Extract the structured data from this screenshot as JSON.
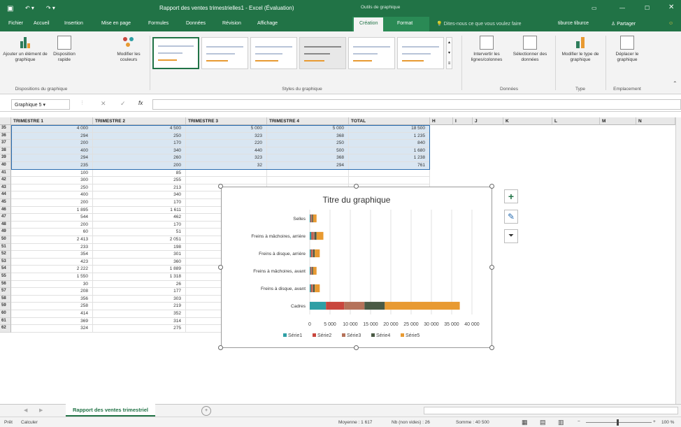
{
  "window": {
    "title": "Rapport des ventes trimestrielles1 - Excel (Évaluation)",
    "context_group": "Outils de graphique",
    "user": "tiburce tiburce"
  },
  "tabs": [
    "Fichier",
    "Accueil",
    "Insertion",
    "Mise en page",
    "Formules",
    "Données",
    "Révision",
    "Affichage",
    "Création",
    "Format"
  ],
  "active_tab": "Création",
  "tell_me": "Dites-nous ce que vous voulez faire",
  "share_label": "Partager",
  "ribbon": {
    "add_element": "Ajouter un élément de graphique",
    "quick_layout": "Disposition rapide",
    "group_layouts": "Dispositions du graphique",
    "change_colors": "Modifier les couleurs",
    "group_styles": "Styles du graphique",
    "switch_rowcol": "Intervertir les lignes/colonnes",
    "select_data": "Sélectionner des données",
    "group_data": "Données",
    "change_type": "Modifier le type de graphique",
    "group_type": "Type",
    "move_chart": "Déplacer le graphique",
    "group_location": "Emplacement"
  },
  "formula_bar": {
    "name_box": "Graphique 5",
    "fx": "fx",
    "value": ""
  },
  "columns": [
    "TRIMESTRE 1",
    "TRIMESTRE 2",
    "TRIMESTRE 3",
    "TRIMESTRE 4",
    "TOTAL",
    "H",
    "I",
    "J",
    "K",
    "L",
    "M",
    "N"
  ],
  "rows": [
    {
      "n": "35",
      "c": [
        "4 000",
        "4 500",
        "5 000",
        "5 000",
        "18 500"
      ]
    },
    {
      "n": "36",
      "c": [
        "294",
        "250",
        "323",
        "368",
        "1 235"
      ]
    },
    {
      "n": "37",
      "c": [
        "200",
        "170",
        "220",
        "250",
        "840"
      ]
    },
    {
      "n": "38",
      "c": [
        "400",
        "340",
        "440",
        "500",
        "1 680"
      ]
    },
    {
      "n": "39",
      "c": [
        "294",
        "260",
        "323",
        "368",
        "1 238"
      ]
    },
    {
      "n": "40",
      "c": [
        "235",
        "200",
        "32",
        "294",
        "761"
      ]
    },
    {
      "n": "41",
      "c": [
        "100",
        "85",
        "",
        "",
        ""
      ]
    },
    {
      "n": "42",
      "c": [
        "300",
        "255",
        "",
        "",
        ""
      ]
    },
    {
      "n": "43",
      "c": [
        "250",
        "213",
        "",
        "",
        ""
      ]
    },
    {
      "n": "44",
      "c": [
        "400",
        "340",
        "",
        "",
        ""
      ]
    },
    {
      "n": "45",
      "c": [
        "200",
        "170",
        "",
        "",
        ""
      ]
    },
    {
      "n": "46",
      "c": [
        "1 895",
        "1 611",
        "",
        "",
        ""
      ]
    },
    {
      "n": "47",
      "c": [
        "544",
        "462",
        "",
        "",
        ""
      ]
    },
    {
      "n": "48",
      "c": [
        "200",
        "170",
        "",
        "",
        ""
      ]
    },
    {
      "n": "49",
      "c": [
        "60",
        "51",
        "",
        "",
        ""
      ]
    },
    {
      "n": "50",
      "c": [
        "2 413",
        "2 051",
        "",
        "",
        ""
      ]
    },
    {
      "n": "51",
      "c": [
        "233",
        "198",
        "",
        "",
        ""
      ]
    },
    {
      "n": "52",
      "c": [
        "354",
        "301",
        "",
        "",
        ""
      ]
    },
    {
      "n": "53",
      "c": [
        "423",
        "360",
        "",
        "",
        ""
      ]
    },
    {
      "n": "54",
      "c": [
        "2 222",
        "1 889",
        "",
        "",
        ""
      ]
    },
    {
      "n": "55",
      "c": [
        "1 550",
        "1 318",
        "",
        "",
        ""
      ]
    },
    {
      "n": "56",
      "c": [
        "30",
        "26",
        "",
        "",
        ""
      ]
    },
    {
      "n": "57",
      "c": [
        "208",
        "177",
        "",
        "",
        ""
      ]
    },
    {
      "n": "58",
      "c": [
        "356",
        "303",
        "390",
        "445",
        "1 496"
      ]
    },
    {
      "n": "59",
      "c": [
        "258",
        "219",
        "284",
        "322",
        "1 084"
      ]
    },
    {
      "n": "60",
      "c": [
        "414",
        "352",
        "455",
        "518",
        "1 739"
      ]
    },
    {
      "n": "61",
      "c": [
        "369",
        "314",
        "406",
        "461",
        "1 550"
      ]
    },
    {
      "n": "62",
      "c": [
        "324",
        "275",
        "356",
        "405",
        "1 361"
      ]
    }
  ],
  "chart_data": {
    "type": "bar",
    "orientation": "horizontal",
    "stacked": true,
    "title": "Titre du graphique",
    "categories": [
      "Selles",
      "Freins à mâchoires, arrière",
      "Freins à disque, arrière",
      "Freins à mâchoires, avant",
      "Freins à disque, avant",
      "Cadres"
    ],
    "series": [
      {
        "name": "Série1",
        "color": "#2e9fa5",
        "values": [
          200,
          400,
          294,
          200,
          294,
          4000
        ]
      },
      {
        "name": "Série2",
        "color": "#c9463d",
        "values": [
          170,
          340,
          250,
          170,
          250,
          4500
        ]
      },
      {
        "name": "Série3",
        "color": "#b5725a",
        "values": [
          220,
          440,
          323,
          220,
          323,
          5000
        ]
      },
      {
        "name": "Série4",
        "color": "#4a5a45",
        "values": [
          250,
          500,
          368,
          250,
          368,
          5000
        ]
      },
      {
        "name": "Série5",
        "color": "#e89a32",
        "values": [
          840,
          1680,
          1235,
          840,
          1235,
          18500
        ]
      }
    ],
    "x_ticks": [
      "0",
      "5 000",
      "10 000",
      "15 000",
      "20 000",
      "25 000",
      "30 000",
      "35 000",
      "40 000"
    ],
    "xlim": [
      0,
      40000
    ],
    "grid": "vertical",
    "legend": "bottom"
  },
  "sheet_tab": "Rapport des ventes trimestriel",
  "status": {
    "mode": "Prêt",
    "calc": "Calculer",
    "average": "Moyenne : 1 617",
    "count": "Nb (non vides) : 26",
    "sum": "Somme : 40 500",
    "zoom": "100 %"
  }
}
